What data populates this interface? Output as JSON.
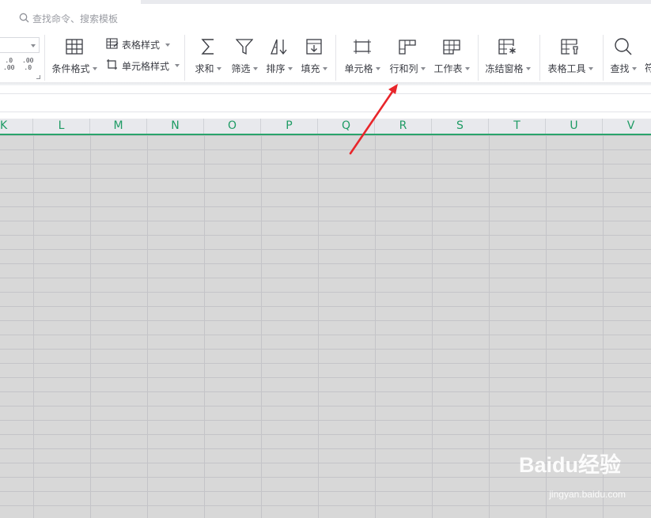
{
  "search": {
    "placeholder": "查找命令、搜索模板"
  },
  "ribbon": {
    "decimal_increase": [
      ".0",
      ".00"
    ],
    "decimal_decrease": [
      ".00",
      ".0"
    ],
    "tools": {
      "conditional_format": "条件格式",
      "table_style": "表格样式",
      "cell_style": "单元格样式",
      "sum": "求和",
      "filter": "筛选",
      "sort": "排序",
      "fill": "填充",
      "cell": "单元格",
      "rows_cols": "行和列",
      "worksheet": "工作表",
      "freeze": "冻结窗格",
      "table_tools": "表格工具",
      "find": "查找",
      "cut_off": "符"
    }
  },
  "sheet": {
    "columns": [
      "K",
      "L",
      "M",
      "N",
      "O",
      "P",
      "Q",
      "R",
      "S",
      "T",
      "U",
      "V"
    ]
  },
  "watermark": {
    "brand": "Baidu经验",
    "url": "jingyan.baidu.com"
  },
  "colors": {
    "accent_green": "#1e9b64",
    "arrow_red": "#e8262b",
    "sheet_fill": "#d8d8d8"
  }
}
